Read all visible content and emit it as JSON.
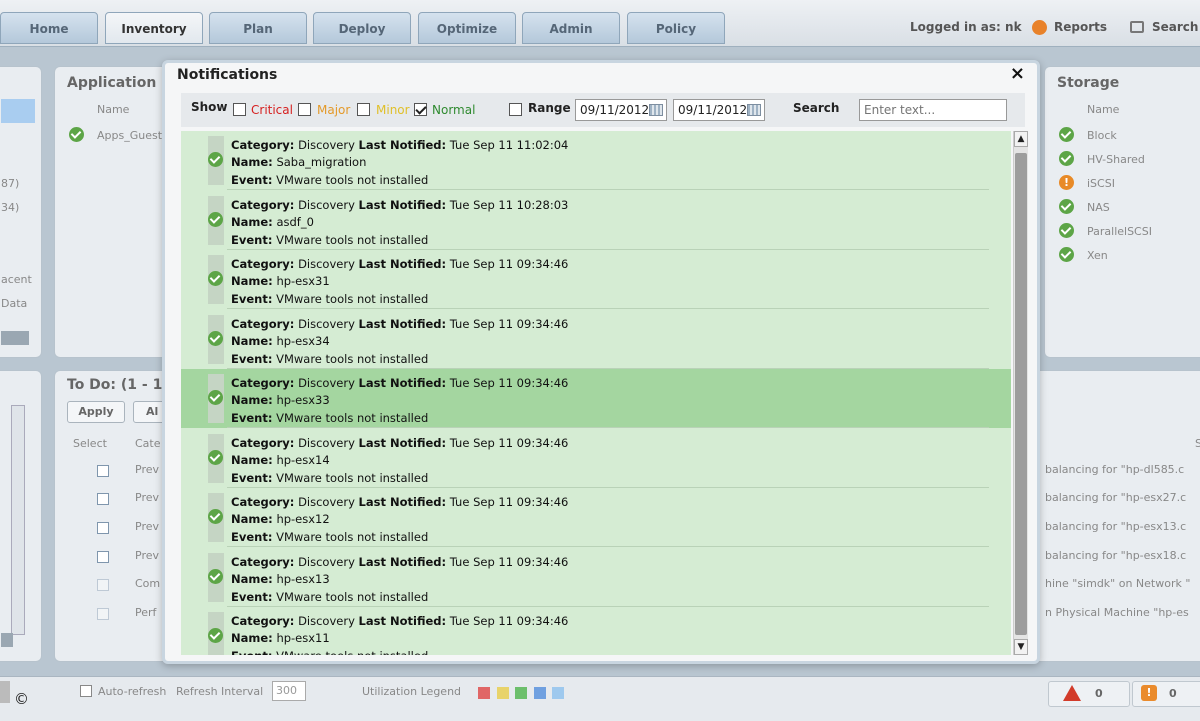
{
  "nav": {
    "tabs": [
      {
        "label": "Home"
      },
      {
        "label": "Inventory"
      },
      {
        "label": "Plan"
      },
      {
        "label": "Deploy"
      },
      {
        "label": "Optimize"
      },
      {
        "label": "Admin"
      },
      {
        "label": "Policy"
      }
    ],
    "logged_in": "Logged in as: nk",
    "reports": "Reports",
    "search": "Search"
  },
  "background": {
    "application_title": "Application",
    "application_col": "Name",
    "application_row": "Apps_Guest",
    "left_fragments": [
      "87)",
      "34)",
      "acent",
      "Data"
    ],
    "storage_title": "Storage",
    "storage_col": "Name",
    "storage_items": [
      {
        "name": "Block",
        "status": "ok"
      },
      {
        "name": "HV-Shared",
        "status": "ok"
      },
      {
        "name": "iSCSI",
        "status": "warning"
      },
      {
        "name": "NAS",
        "status": "ok"
      },
      {
        "name": "ParallelSCSI",
        "status": "ok"
      },
      {
        "name": "Xen",
        "status": "ok"
      }
    ],
    "todo_title": "To Do: (1 - 1",
    "todo_apply": "Apply",
    "todo_all": "Al",
    "todo_cols": [
      "Select",
      "Cate"
    ],
    "todo_rows": [
      "Prev",
      "Prev",
      "Prev",
      "Prev",
      "Com",
      "Perf"
    ],
    "right_rows": [
      "balancing for \"hp-dl585.c",
      "balancing for \"hp-esx27.c",
      "balancing for \"hp-esx13.c",
      "balancing for \"hp-esx18.c",
      "hine \"simdk\" on Network \"",
      "n Physical Machine \"hp-es"
    ],
    "right_col": "S"
  },
  "modal": {
    "title": "Notifications",
    "close": "×",
    "filter": {
      "show_label": "Show",
      "critical": "Critical",
      "major": "Major",
      "minor": "Minor",
      "normal": "Normal",
      "range_label": "Range",
      "date_from": "09/11/2012",
      "date_to": "09/11/2012",
      "search_label": "Search",
      "search_placeholder": "Enter text..."
    },
    "labels": {
      "category": "Category:",
      "last_notified": "Last Notified:",
      "name": "Name:",
      "event": "Event:"
    },
    "notifications": [
      {
        "category": "Discovery",
        "last_notified": "Tue Sep 11 11:02:04",
        "name": "Saba_migration",
        "event": "VMware tools not installed"
      },
      {
        "category": "Discovery",
        "last_notified": "Tue Sep 11 10:28:03",
        "name": "asdf_0",
        "event": "VMware tools not installed"
      },
      {
        "category": "Discovery",
        "last_notified": "Tue Sep 11 09:34:46",
        "name": "hp-esx31",
        "event": "VMware tools not installed"
      },
      {
        "category": "Discovery",
        "last_notified": "Tue Sep 11 09:34:46",
        "name": "hp-esx34",
        "event": "VMware tools not installed"
      },
      {
        "category": "Discovery",
        "last_notified": "Tue Sep 11 09:34:46",
        "name": "hp-esx33",
        "event": "VMware tools not installed",
        "selected": true
      },
      {
        "category": "Discovery",
        "last_notified": "Tue Sep 11 09:34:46",
        "name": "hp-esx14",
        "event": "VMware tools not installed"
      },
      {
        "category": "Discovery",
        "last_notified": "Tue Sep 11 09:34:46",
        "name": "hp-esx12",
        "event": "VMware tools not installed"
      },
      {
        "category": "Discovery",
        "last_notified": "Tue Sep 11 09:34:46",
        "name": "hp-esx13",
        "event": "VMware tools not installed"
      },
      {
        "category": "Discovery",
        "last_notified": "Tue Sep 11 09:34:46",
        "name": "hp-esx11",
        "event": "VMware tools not installed"
      }
    ]
  },
  "bottom": {
    "auto_refresh": "Auto-refresh",
    "refresh_interval_label": "Refresh Interval",
    "refresh_interval": "300",
    "legend_label": "Utilization Legend",
    "legend_colors": [
      "#e06666",
      "#e8d36a",
      "#6cbf6c",
      "#6fa0e0",
      "#9ec9ee"
    ],
    "critical_count": "0",
    "warning_count": "0",
    "copyright": "©"
  },
  "colors": {
    "critical": "#d62020",
    "major": "#e49a2a",
    "minor": "#e0c02a",
    "normal": "#2f8a2f",
    "selected_row": "#a4d6a0",
    "list_bg": "#d5ecd3"
  }
}
